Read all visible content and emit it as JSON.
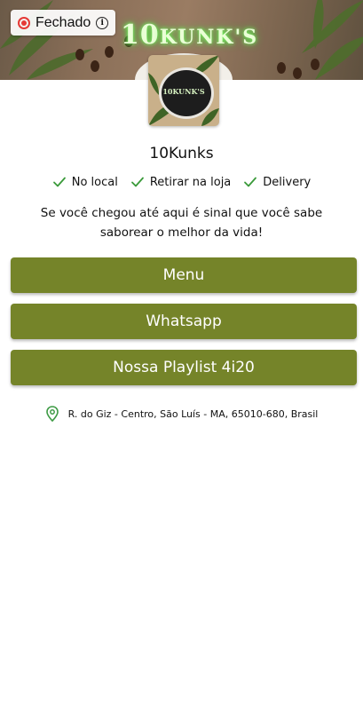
{
  "status": {
    "label": "Fechado",
    "color": "#e53935",
    "icon": "info-icon"
  },
  "banner": {
    "title_big": "10",
    "title_rest": "KUNK'S"
  },
  "logo": {
    "text": "10KUNK'S"
  },
  "store": {
    "name": "10Kunks"
  },
  "features": [
    {
      "label": "No local",
      "icon": "check-icon"
    },
    {
      "label": "Retirar na loja",
      "icon": "check-icon"
    },
    {
      "label": "Delivery",
      "icon": "check-icon"
    }
  ],
  "description": "Se você chegou até aqui é sinal que você sabe saborear o melhor da vida!",
  "buttons": [
    {
      "label": "Menu"
    },
    {
      "label": "Whatsapp"
    },
    {
      "label": "Nossa Playlist 4i20"
    }
  ],
  "address": {
    "text": "R. do Giz - Centro, São Luís - MA, 65010-680, Brasil",
    "icon": "map-pin-icon"
  },
  "colors": {
    "accent": "#758429",
    "check": "#3a9a3a",
    "pin": "#3e9b45"
  }
}
